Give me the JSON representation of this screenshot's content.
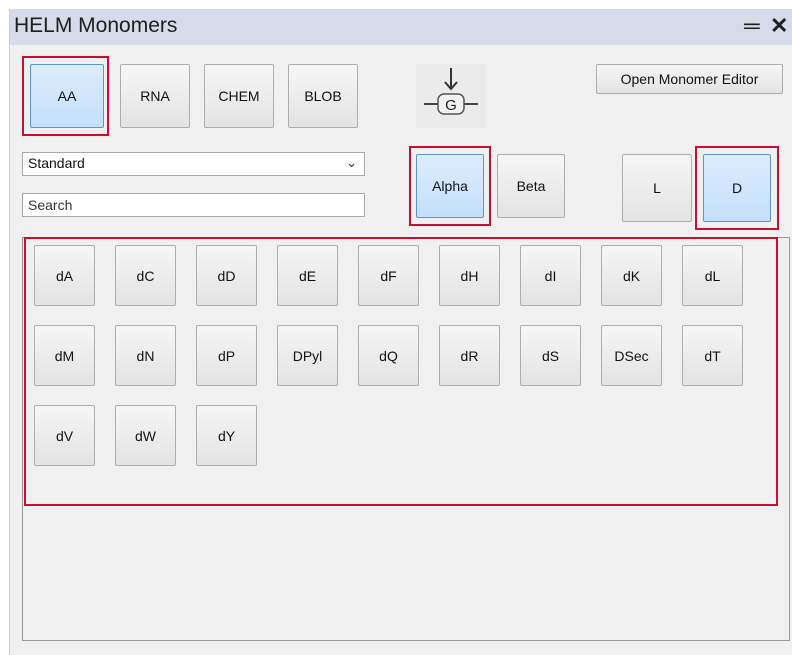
{
  "window": {
    "title": "HELM Monomers",
    "minimize_icon": "minimize-icon",
    "close_icon": "close-icon"
  },
  "polymer_types": [
    {
      "label": "AA",
      "selected": true
    },
    {
      "label": "RNA",
      "selected": false
    },
    {
      "label": "CHEM",
      "selected": false
    },
    {
      "label": "BLOB",
      "selected": false
    }
  ],
  "g_icon": "g-icon",
  "open_editor_label": "Open Monomer Editor",
  "filter": {
    "selected": "Standard",
    "search_placeholder": "Search"
  },
  "backbone": [
    {
      "label": "Alpha",
      "selected": true
    },
    {
      "label": "Beta",
      "selected": false
    }
  ],
  "chirality": [
    {
      "label": "L",
      "selected": false
    },
    {
      "label": "D",
      "selected": true
    }
  ],
  "monomers": [
    "dA",
    "dC",
    "dD",
    "dE",
    "dF",
    "dH",
    "dI",
    "dK",
    "dL",
    "dM",
    "dN",
    "dP",
    "DPyl",
    "dQ",
    "dR",
    "dS",
    "DSec",
    "dT",
    "dV",
    "dW",
    "dY"
  ],
  "colors": {
    "selected_fill": "#c4e0fc",
    "selected_border": "#5e95cf",
    "highlight": "#c8102e",
    "titlebar": "#d6dbe9"
  }
}
